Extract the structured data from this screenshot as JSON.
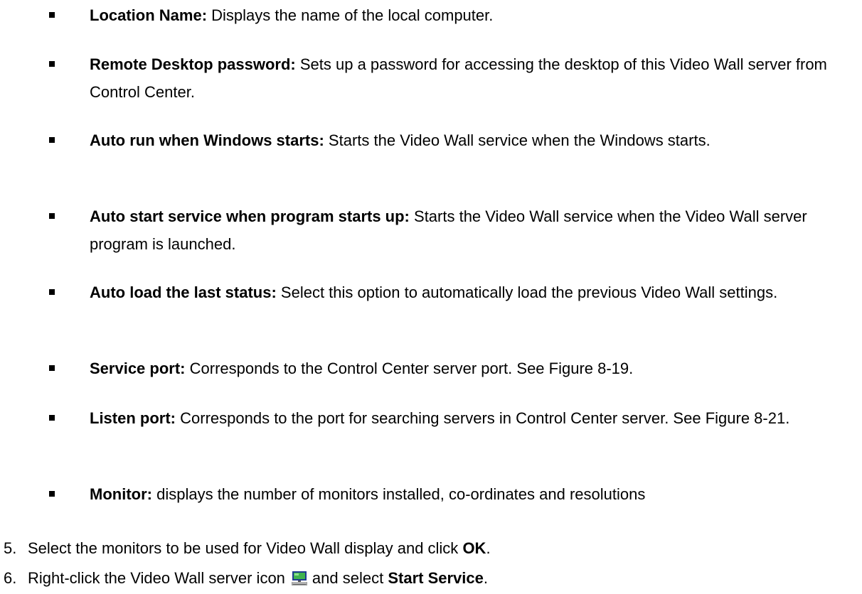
{
  "bullets": [
    {
      "term": "Location Name:",
      "desc": "Displays the name of the local computer."
    },
    {
      "term": "Remote Desktop password:",
      "desc": "Sets up a password for accessing the desktop of this Video Wall server from Control Center."
    },
    {
      "term": "Auto run when Windows starts:",
      "desc": "Starts the Video Wall service when the Windows starts."
    },
    {
      "term": "Auto start service when program starts up:",
      "desc": "Starts the Video Wall service when the Video Wall server program is launched."
    },
    {
      "term": "Auto load the last status:",
      "desc": "Select this option to automatically load the previous Video Wall settings."
    },
    {
      "term": "Service port:",
      "desc": "Corresponds to the Control Center server port. See Figure 8-19."
    },
    {
      "term": "Listen port:",
      "desc": "Corresponds to the port for searching servers in Control Center server. See Figure 8-21."
    },
    {
      "term": "Monitor:",
      "desc": "displays the number of monitors installed, co-ordinates and resolutions"
    }
  ],
  "steps": [
    {
      "num": "5.",
      "pre": "Select the monitors to be used for Video Wall display and click ",
      "bold": "OK",
      "post": "."
    },
    {
      "num": "6.",
      "pre": "Right-click the Video Wall server icon",
      "icon": "monitor-server-icon",
      "mid": "and select ",
      "bold": "Start Service",
      "post": "."
    }
  ]
}
